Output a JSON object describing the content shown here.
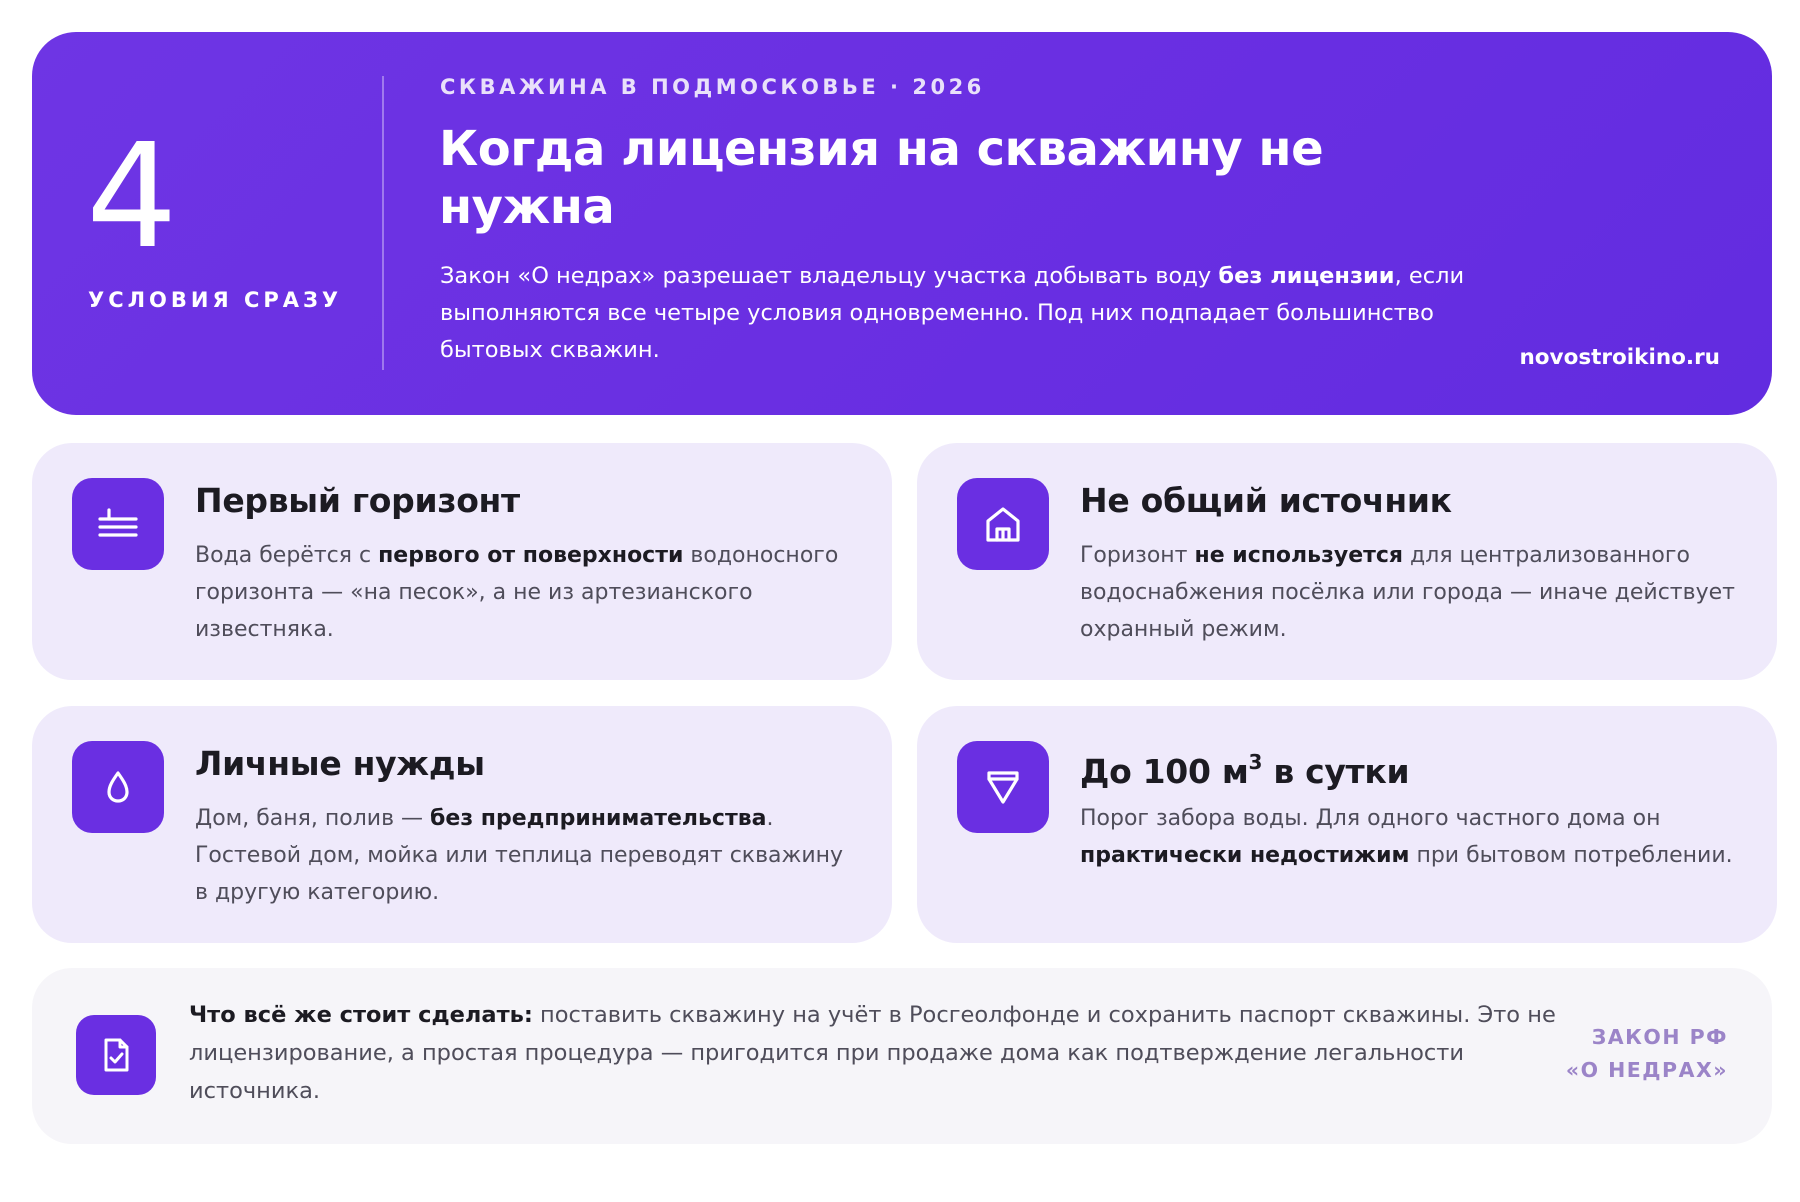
{
  "colors": {
    "accent": "#6a2fe2",
    "card_bg": "#efeafb",
    "note_bg": "#f6f5f9",
    "law_label": "#9b84c8"
  },
  "hero": {
    "number": "4",
    "number_label": "УСЛОВИЯ СРАЗУ",
    "eyebrow": "СКВАЖИНА В ПОДМОСКОВЬЕ · 2026",
    "title": "Когда лицензия на скважину не нужна",
    "desc_before": "Закон «О недрах» разрешает владельцу участка добывать воду ",
    "desc_bold": "без лицензии",
    "desc_after": ", если выполняются все четыре условия одновременно. Под них подпадает большинство бытовых скважин.",
    "site": "novostroikino.ru"
  },
  "cards": [
    {
      "icon": "layers-icon",
      "title": "Первый горизонт",
      "text_before": "Вода берётся с ",
      "text_bold": "первого от поверхности",
      "text_after": " водоносного горизонта — «на песок», а не из артезианского известняка."
    },
    {
      "icon": "house-icon",
      "title": "Не общий источник",
      "text_before": "Горизонт ",
      "text_bold": "не используется",
      "text_after": " для централизованного водоснабжения посёлка или города — иначе действует охранный режим."
    },
    {
      "icon": "water-drop-icon",
      "title": "Личные нужды",
      "text_before": "Дом, баня, полив — ",
      "text_bold": "без предпринимательства",
      "text_after": ". Гостевой дом, мойка или теплица переводят скважину в другую категорию."
    },
    {
      "icon": "funnel-limit-icon",
      "title": "До 100 м",
      "title_sup": "3",
      "title_after": " в сутки",
      "text_before": "Порог забора воды. Для одного частного дома он ",
      "text_bold": "практически недостижим",
      "text_after": " при бытовом потреблении."
    }
  ],
  "note": {
    "icon": "document-check-icon",
    "bold": "Что всё же стоит сделать:",
    "text": " поставить скважину на учёт в Росгеолфонде и сохранить паспорт скважины. Это не лицензирование, а простая процедура — пригодится при продаже дома как подтверждение легальности источника.",
    "law_line1": "ЗАКОН РФ",
    "law_line2": "«О НЕДРАХ»"
  }
}
